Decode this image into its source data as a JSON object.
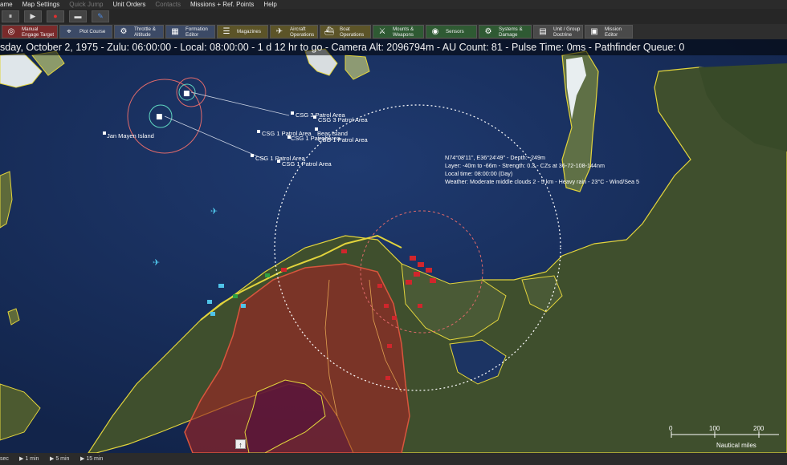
{
  "menu": {
    "items": [
      "ame",
      "Map Settings",
      "Quick Jump",
      "Unit Orders",
      "Contacts",
      "Missions + Ref. Points",
      "Help"
    ],
    "disabled": [
      false,
      false,
      true,
      false,
      true,
      false,
      false
    ]
  },
  "quickbar": {
    "buttons": [
      {
        "name": "pause-icon",
        "glyph": "⏸"
      },
      {
        "name": "play-icon",
        "glyph": "▶"
      },
      {
        "name": "record-icon",
        "glyph": "●"
      },
      {
        "name": "vehicle-icon",
        "glyph": "▬"
      },
      {
        "name": "pencil-icon",
        "glyph": "✎"
      }
    ]
  },
  "toolbar": {
    "buttons": [
      {
        "label": "Manual\nEngage Target",
        "icon": "target-icon",
        "glyph": "◎",
        "color": "#7a2a2a"
      },
      {
        "label": "Plot Course",
        "icon": "course-icon",
        "glyph": "⌖",
        "color": "#3c4a66"
      },
      {
        "label": "Throttle &\nAltitude",
        "icon": "throttle-icon",
        "glyph": "⚙",
        "color": "#3c4a66"
      },
      {
        "label": "Formation\nEditor",
        "icon": "formation-icon",
        "glyph": "▦",
        "color": "#3c4a66"
      },
      {
        "label": "Magazines",
        "icon": "magazine-icon",
        "glyph": "☰",
        "color": "#5c5428"
      },
      {
        "label": "Aircraft\nOperations",
        "icon": "aircraft-icon",
        "glyph": "✈",
        "color": "#5c5428"
      },
      {
        "label": "Boat\nOperations",
        "icon": "boat-icon",
        "glyph": "⛴",
        "color": "#5c5428"
      },
      {
        "label": "Mounts &\nWeapons",
        "icon": "mounts-icon",
        "glyph": "⚔",
        "color": "#2f5a33"
      },
      {
        "label": "Sensors",
        "icon": "sensor-icon",
        "glyph": "◉",
        "color": "#2f5a33"
      },
      {
        "label": "Systems &\nDamage",
        "icon": "systems-icon",
        "glyph": "⚙",
        "color": "#2f5a33"
      },
      {
        "label": "Unit / Group\nDoctrine",
        "icon": "doctrine-icon",
        "glyph": "▤",
        "color": "#4a4a4a"
      },
      {
        "label": "Mission\nEditor",
        "icon": "mission-icon",
        "glyph": "▣",
        "color": "#4a4a4a"
      }
    ]
  },
  "status": {
    "text": "sday, October 2, 1975 - Zulu: 06:00:00 - Local: 08:00:00 - 1 d 12 hr to go -  Camera Alt: 2096794m  - AU Count: 81 - Pulse Time: 0ms - Pathfinder Queue: 0"
  },
  "map": {
    "colors": {
      "sea": "#1d3566",
      "land": "#3c4d2e",
      "coast": "#e2d43c",
      "zone": "#9e2424",
      "ring": "#ffffff",
      "range": "#e06a6a"
    },
    "labels": {
      "jan_mayen": "Jan Mayen Island",
      "csg3_patrol": "CSG 3 Patrol Area",
      "csg1_patrol": "CSG 1 Patrol Area",
      "bear_island": "Bear Island"
    },
    "cursor_info": [
      "N74°08'11\", E36°24'49\" - Depth: -249m",
      "Layer: -40m to -66m - Strength: 0.3 - CZs at 36-72-108-144nm",
      "Local time: 08:00:00 (Day)",
      "Weather: Moderate middle clouds 2 - 5 km - Heavy rain - 23°C - Wind/Sea 5"
    ]
  },
  "scale": {
    "ticks": [
      "0",
      "100",
      "200"
    ],
    "unit": "Nautical miles"
  },
  "timebar": {
    "items": [
      "sec",
      "1 min",
      "5 min",
      "15 min"
    ]
  }
}
